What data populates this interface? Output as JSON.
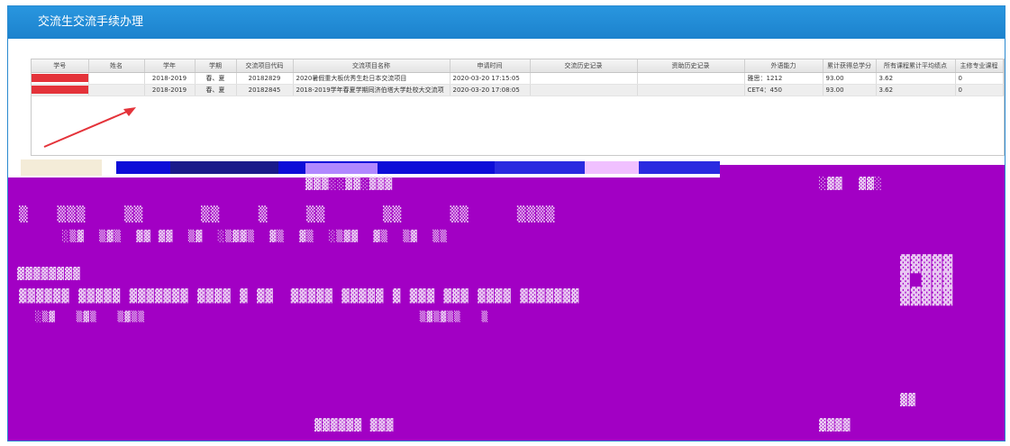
{
  "window": {
    "title": "交流生交流手续办理"
  },
  "grid": {
    "columns": [
      "学号",
      "姓名",
      "学年",
      "学期",
      "交流项目代码",
      "交流项目名称",
      "申请时间",
      "交流历史记录",
      "资助历史记录",
      "外语能力",
      "累计获得总学分",
      "所有课程累计平均绩点",
      "主修专业课程"
    ],
    "rows": [
      {
        "student_id": "",
        "name": "",
        "year": "2018-2019",
        "term": "春、夏",
        "project_code": "20182829",
        "project_name": "2020暑假重大板优秀生赴日本交流项目",
        "apply_time": "2020-03-20 17:15:05",
        "exchange_history": "",
        "funding_history": "",
        "language": "雅思：1212",
        "credits": "93.00",
        "gpa": "3.62",
        "major_courses": "0"
      },
      {
        "student_id": "",
        "name": "",
        "year": "2018-2019",
        "term": "春、夏",
        "project_code": "20182845",
        "project_name": "2018-2019学年春夏学期同济伯塔大学赴校大交流项",
        "apply_time": "2020-03-20 17:08:05",
        "exchange_history": "",
        "funding_history": "",
        "language": "CET4：450",
        "credits": "93.00",
        "gpa": "3.62",
        "major_courses": "0"
      }
    ]
  },
  "annotation": {
    "arrow_color": "#e4333a",
    "redaction_color": "#e4333a"
  },
  "corrupted_region": {
    "color": "#a200c4"
  },
  "colors": {
    "titlebar": "#1c82cd",
    "border": "#2a8ad0"
  }
}
